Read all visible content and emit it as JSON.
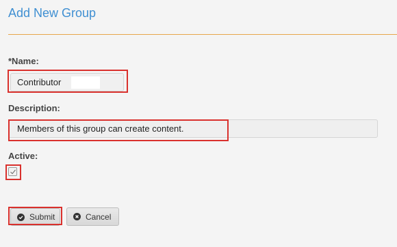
{
  "page": {
    "title": "Add New Group"
  },
  "form": {
    "name_label": "*Name:",
    "name_value": "Contributor",
    "description_label": "Description:",
    "description_value": "Members of this group can create content.",
    "active_label": "Active:",
    "active_checked": true
  },
  "buttons": {
    "submit": {
      "label": "Submit",
      "icon": "check-circle-icon"
    },
    "cancel": {
      "label": "Cancel",
      "icon": "close-circle-icon"
    }
  },
  "colors": {
    "title": "#3f8fd2",
    "rule": "#e6a64a",
    "highlight": "#d9302c"
  }
}
